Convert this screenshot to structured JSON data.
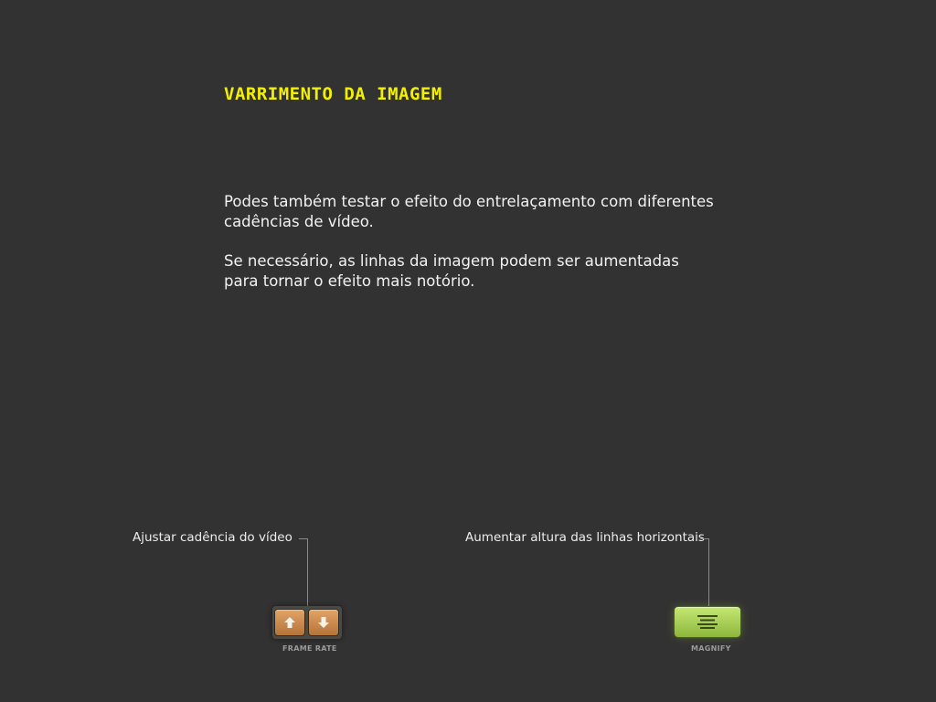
{
  "screen": {
    "title": "VARRIMENTO DA IMAGEM",
    "paragraphs": [
      "Podes também testar o efeito do entrelaçamento com diferentes cadências de vídeo.",
      "Se necessário, as linhas da imagem podem ser aumentadas para tornar o efeito mais notório."
    ]
  },
  "callouts": {
    "frame_rate": "Ajustar cadência do vídeo",
    "magnify": "Aumentar altura das linhas horizontais"
  },
  "controls": {
    "frame_rate": {
      "caption": "FRAME RATE",
      "up_icon": "arrow-up-icon",
      "down_icon": "arrow-down-icon"
    },
    "magnify": {
      "caption": "MAGNIFY",
      "icon": "lines-icon"
    }
  },
  "colors": {
    "background": "#323232",
    "title": "#f2f000",
    "body_text": "#f2f2f2",
    "frame_rate_button": "#d08f50",
    "magnify_button": "#a9d355"
  }
}
